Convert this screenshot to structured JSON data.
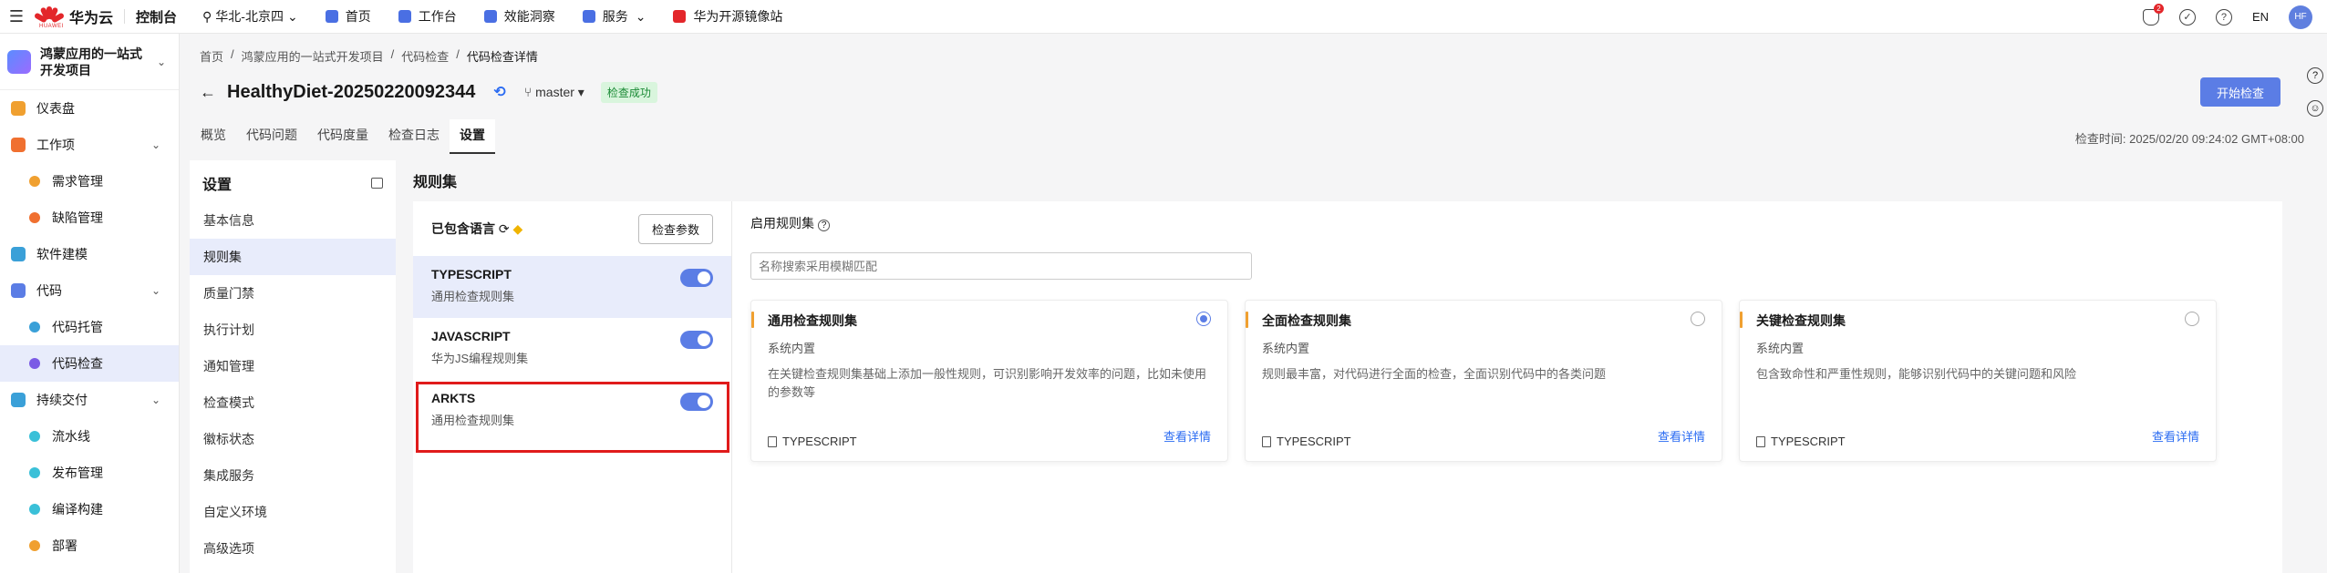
{
  "topnav": {
    "brand": "华为云",
    "brand_sub": "HUAWEI",
    "console": "控制台",
    "region": "华北-北京四",
    "links": [
      {
        "label": "首页",
        "color": "#4a6fe3"
      },
      {
        "label": "工作台",
        "color": "#4a6fe3"
      },
      {
        "label": "效能洞察",
        "color": "#4a6fe3"
      },
      {
        "label": "服务",
        "color": "#4a6fe3"
      },
      {
        "label": "华为开源镜像站",
        "color": "#e3262a"
      }
    ],
    "notif_count": "2",
    "lang": "EN",
    "avatar": "HF"
  },
  "sidebar": {
    "project": "鸿蒙应用的一站式开发项目",
    "items": [
      {
        "label": "仪表盘",
        "color": "#f0a030"
      },
      {
        "label": "工作项",
        "color": "#f07030"
      },
      {
        "label": "需求管理",
        "color": "#f0a030"
      },
      {
        "label": "缺陷管理",
        "color": "#f07030"
      },
      {
        "label": "软件建模",
        "color": "#3aa0d8"
      },
      {
        "label": "代码",
        "color": "#5b7de5"
      },
      {
        "label": "代码托管",
        "color": "#3aa0d8"
      },
      {
        "label": "代码检查",
        "color": "#7b5be5"
      },
      {
        "label": "持续交付",
        "color": "#3aa0d8"
      },
      {
        "label": "流水线",
        "color": "#3ac0d8"
      },
      {
        "label": "发布管理",
        "color": "#3ac0d8"
      },
      {
        "label": "编译构建",
        "color": "#3ac0d8"
      },
      {
        "label": "部署",
        "color": "#f0a030"
      }
    ]
  },
  "breadcrumb": [
    "首页",
    "/",
    "鸿蒙应用的一站式开发项目",
    "/",
    "代码检查",
    "/",
    "代码检查详情"
  ],
  "header": {
    "title": "HealthyDiet-20250220092344",
    "branch": "master",
    "status": "检查成功",
    "start_button": "开始检查",
    "check_time": "检查时间: 2025/02/20 09:24:02 GMT+08:00"
  },
  "tabs": [
    "概览",
    "代码问题",
    "代码度量",
    "检查日志",
    "设置"
  ],
  "settings": {
    "title": "设置",
    "items": [
      "基本信息",
      "规则集",
      "质量门禁",
      "执行计划",
      "通知管理",
      "检查模式",
      "徽标状态",
      "集成服务",
      "自定义环境",
      "高级选项"
    ]
  },
  "ruleset": {
    "title": "规则集",
    "included_languages": "已包含语言",
    "check_params": "检查参数",
    "languages": [
      {
        "name": "TYPESCRIPT",
        "desc": "通用检查规则集",
        "enabled": true
      },
      {
        "name": "JAVASCRIPT",
        "desc": "华为JS编程规则集",
        "enabled": true
      },
      {
        "name": "ARKTS",
        "desc": "通用检查规则集",
        "enabled": true
      }
    ],
    "enabled_label": "启用规则集",
    "search_placeholder": "名称搜索采用模糊匹配",
    "cards": [
      {
        "name": "通用检查规则集",
        "sub": "系统内置",
        "desc": "在关键检查规则集基础上添加一般性规则，可识别影响开发效率的问题，比如未使用的参数等",
        "lang": "TYPESCRIPT",
        "link": "查看详情",
        "selected": true
      },
      {
        "name": "全面检查规则集",
        "sub": "系统内置",
        "desc": "规则最丰富，对代码进行全面的检查，全面识别代码中的各类问题",
        "lang": "TYPESCRIPT",
        "link": "查看详情",
        "selected": false
      },
      {
        "name": "关键检查规则集",
        "sub": "系统内置",
        "desc": "包含致命性和严重性规则，能够识别代码中的关键问题和风险",
        "lang": "TYPESCRIPT",
        "link": "查看详情",
        "selected": false
      }
    ]
  }
}
